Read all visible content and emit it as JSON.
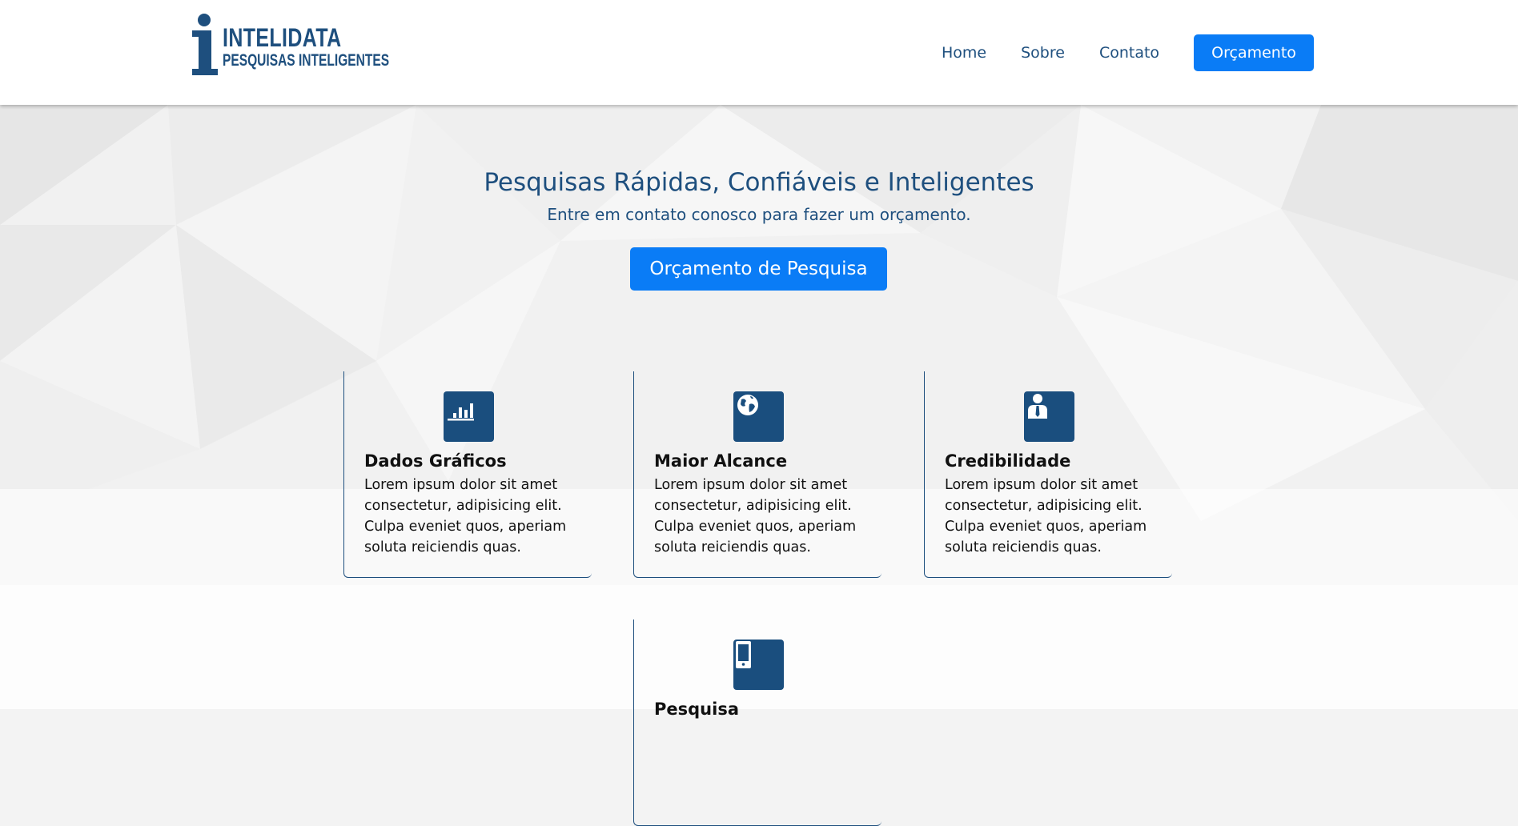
{
  "header": {
    "logo_title": "INTELIDATA",
    "logo_subtitle": "PESQUISAS INTELIGENTES",
    "nav": {
      "home": "Home",
      "sobre": "Sobre",
      "contato": "Contato",
      "orcamento": "Orçamento"
    }
  },
  "hero": {
    "title": "Pesquisas Rápidas, Confiáveis e Inteligentes",
    "subtitle": "Entre em contato conosco para fazer um orçamento.",
    "button": "Orçamento de Pesquisa"
  },
  "cards": [
    {
      "icon": "bar-chart-icon",
      "title": "Dados Gráficos",
      "text": "Lorem ipsum dolor sit amet consectetur, adipisicing elit. Culpa eveniet quos, aperiam soluta reiciendis quas."
    },
    {
      "icon": "globe-icon",
      "title": "Maior Alcance",
      "text": "Lorem ipsum dolor sit amet consectetur, adipisicing elit. Culpa eveniet quos, aperiam soluta reiciendis quas."
    },
    {
      "icon": "businessman-icon",
      "title": "Credibilidade",
      "text": "Lorem ipsum dolor sit amet consectetur, adipisicing elit. Culpa eveniet quos, aperiam soluta reiciendis quas."
    },
    {
      "icon": "mobile-phone-icon",
      "title": "Pesquisa"
    }
  ],
  "colors": {
    "brand_blue": "#1e4f7e",
    "accent_blue": "#0a7cf6",
    "icon_bg": "#1a4e7e"
  }
}
